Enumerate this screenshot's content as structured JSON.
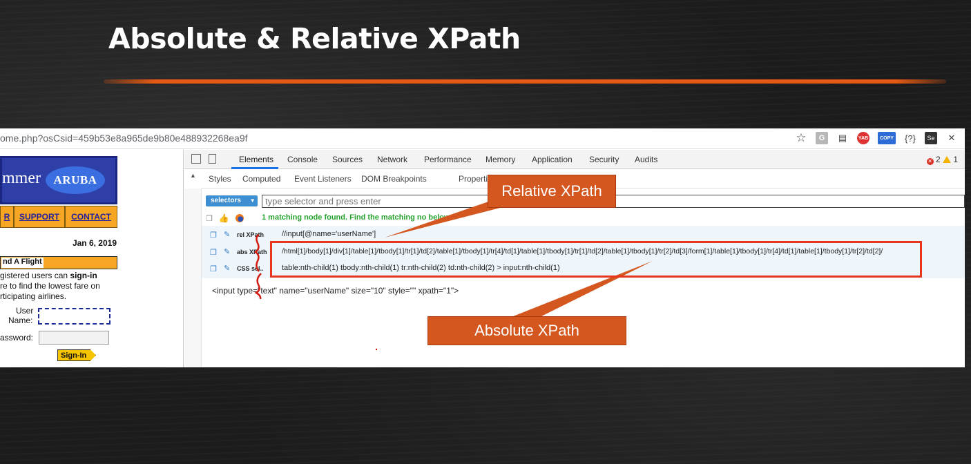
{
  "slide": {
    "title": "Absolute & Relative XPath"
  },
  "browser": {
    "url": "ome.php?osCsid=459b53e8a965de9b80e488932268ea9f",
    "extensions": [
      {
        "icon": "star-icon",
        "glyph": "☆"
      },
      {
        "icon": "g-extension-icon",
        "glyph": "G"
      },
      {
        "icon": "page-extension-icon",
        "glyph": "▤"
      },
      {
        "icon": "yab-extension-icon",
        "glyph": "YAB"
      },
      {
        "icon": "copy-extension-icon",
        "glyph": "COPY"
      },
      {
        "icon": "braces-extension-icon",
        "glyph": "{?}"
      },
      {
        "icon": "se-extension-icon",
        "glyph": "Se"
      },
      {
        "icon": "cross-extension-icon",
        "glyph": "✕"
      }
    ]
  },
  "site": {
    "banner_text": "mmer",
    "logo_text": "ARUBA",
    "nav": [
      "R",
      "SUPPORT",
      "CONTACT"
    ],
    "date": "Jan 6, 2019",
    "flight_label": "nd A Flight",
    "reg_line1_a": "gistered users can ",
    "reg_line1_b": "sign-in",
    "reg_line2": "re to find the lowest fare on",
    "reg_line3": "rticipating airlines.",
    "user_label_1": "User",
    "user_label_2": "Name:",
    "password_label": "assword:",
    "signin_label": "Sign-In"
  },
  "devtools": {
    "tabs": [
      "Elements",
      "Console",
      "Sources",
      "Network",
      "Performance",
      "Memory",
      "Application",
      "Security",
      "Audits"
    ],
    "active_tab": "Elements",
    "error_count": "2",
    "warning_count": "1",
    "sub_tabs": [
      "Styles",
      "Computed",
      "Event Listeners",
      "DOM Breakpoints",
      "Properties"
    ],
    "selector_button": "selectors",
    "selector_placeholder": "type selector and press enter",
    "match_text": "1 matching node found. Find the matching no",
    "match_text_tail": " below :",
    "rows": [
      {
        "label": "rel XPath",
        "value": "//input[@name='userName']"
      },
      {
        "label": "abs XPath",
        "value": "/html[1]/body[1]/div[1]/table[1]/tbody[1]/tr[1]/td[2]/table[1]/tbody[1]/tr[4]/td[1]/table[1]/tbody[1]/tr[1]/td[2]/table[1]/tbody[1]/tr[2]/td[3]/form[1]/table[1]/tbody[1]/tr[4]/td[1]/table[1]/tbody[1]/tr[2]/td[2]/"
      },
      {
        "label": "CSS sel..",
        "value": "table:nth-child(1) tbody:nth-child(1) tr:nth-child(2) td:nth-child(2) > input:nth-child(1)"
      }
    ],
    "html_snippet": "<input type=\"text\" name=\"userName\" size=\"10\" style=\"\" xpath=\"1\">"
  },
  "annotations": {
    "relative": "Relative XPath",
    "absolute": "Absolute XPath",
    "accent": "#d4571f",
    "box_color": "#e8361c"
  }
}
